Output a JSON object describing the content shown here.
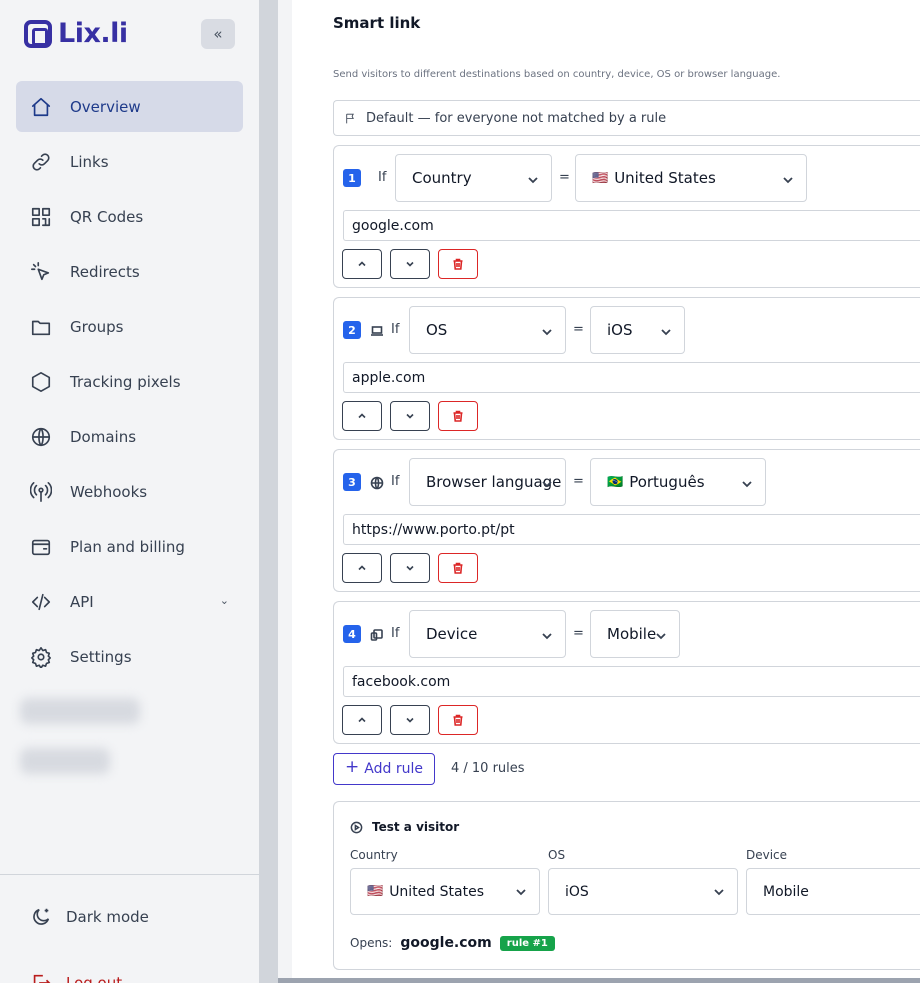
{
  "app": {
    "logo_text": "Lix.li",
    "collapse_glyph": "«"
  },
  "sidebar": {
    "items": [
      {
        "label": "Overview",
        "icon": "home-icon"
      },
      {
        "label": "Links",
        "icon": "link-icon"
      },
      {
        "label": "QR Codes",
        "icon": "qr-code-icon"
      },
      {
        "label": "Redirects",
        "icon": "pointer-icon"
      },
      {
        "label": "Groups",
        "icon": "folder-icon"
      },
      {
        "label": "Tracking pixels",
        "icon": "hexagon-icon"
      },
      {
        "label": "Domains",
        "icon": "globe-icon"
      },
      {
        "label": "Webhooks",
        "icon": "antenna-icon"
      },
      {
        "label": "Plan and billing",
        "icon": "wallet-icon"
      },
      {
        "label": "API",
        "icon": "code-icon"
      },
      {
        "label": "Settings",
        "icon": "gear-icon"
      }
    ],
    "dark_mode_label": "Dark mode",
    "logout_label": "Log out"
  },
  "panel": {
    "title": "Smart link",
    "description": "Send visitors to different destinations based on country, device, OS or browser language.",
    "default_label": "Default — for everyone not matched by a rule",
    "if_label": "If",
    "eq_label": "=",
    "rules": [
      {
        "num": "1",
        "type": "Country",
        "value": "United States",
        "flag": "🇺🇸",
        "dest": "google.com"
      },
      {
        "num": "2",
        "type": "OS",
        "value": "iOS",
        "flag": "",
        "dest": "apple.com"
      },
      {
        "num": "3",
        "type": "Browser language",
        "value": "Português",
        "flag": "🇧🇷",
        "dest": "https://www.porto.pt/pt"
      },
      {
        "num": "4",
        "type": "Device",
        "value": "Mobile",
        "flag": "",
        "dest": "facebook.com"
      }
    ],
    "add_rule_label": "Add rule",
    "rule_count": "4 / 10 rules"
  },
  "test": {
    "title": "Test a visitor",
    "country_label": "Country",
    "country_value": "United States",
    "country_flag": "🇺🇸",
    "os_label": "OS",
    "os_value": "iOS",
    "device_label": "Device",
    "device_value": "Mobile",
    "opens_label": "Opens:",
    "opens_value": "google.com",
    "badge": "rule #1"
  },
  "colors": {
    "accent": "#2563eb",
    "brand": "#3730a3",
    "danger": "#dc2626",
    "success": "#16a34a"
  }
}
